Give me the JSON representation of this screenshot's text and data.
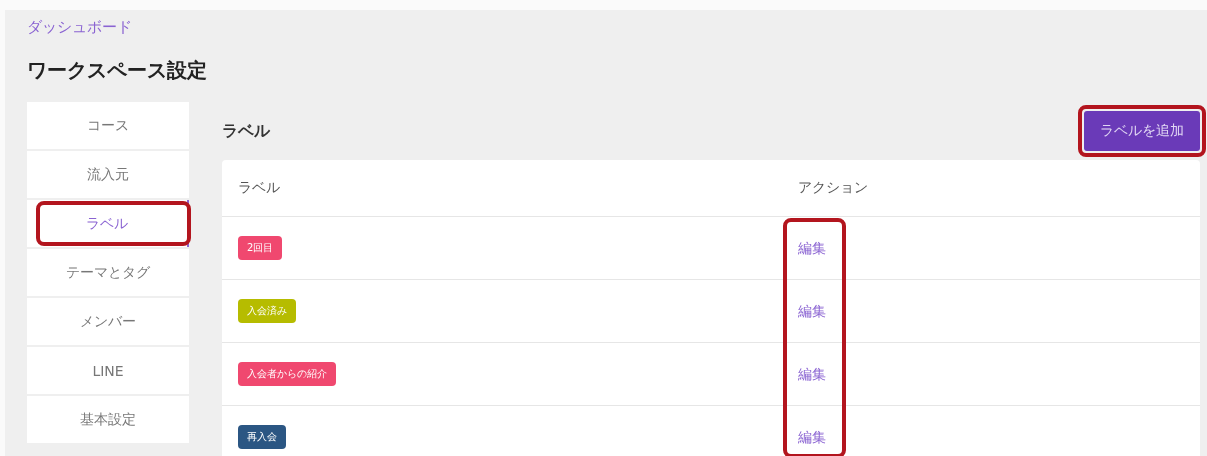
{
  "breadcrumb": "ダッシュボード",
  "title": "ワークスペース設定",
  "sidebar": {
    "items": [
      {
        "label": "コース",
        "selected": false,
        "highlighted": false
      },
      {
        "label": "流入元",
        "selected": false,
        "highlighted": false
      },
      {
        "label": "ラベル",
        "selected": true,
        "highlighted": true
      },
      {
        "label": "テーマとタグ",
        "selected": false,
        "highlighted": false
      },
      {
        "label": "メンバー",
        "selected": false,
        "highlighted": false
      },
      {
        "label": "LINE",
        "selected": false,
        "highlighted": false
      },
      {
        "label": "基本設定",
        "selected": false,
        "highlighted": false
      }
    ]
  },
  "section": {
    "heading": "ラベル",
    "add_button": {
      "label": "ラベルを追加",
      "highlighted": true
    }
  },
  "table": {
    "columns": [
      "ラベル",
      "アクション"
    ],
    "action_column_highlighted": true,
    "rows": [
      {
        "label": "2回目",
        "color": "#f0486f",
        "action": "編集"
      },
      {
        "label": "入会済み",
        "color": "#b6bc00",
        "action": "編集"
      },
      {
        "label": "入会者からの紹介",
        "color": "#f0486f",
        "action": "編集"
      },
      {
        "label": "再入会",
        "color": "#2b5683",
        "action": "編集"
      }
    ]
  }
}
